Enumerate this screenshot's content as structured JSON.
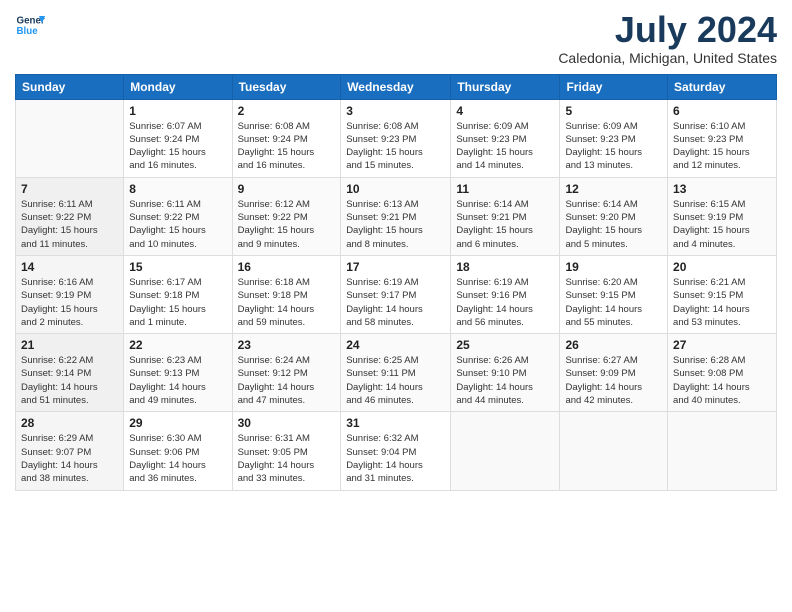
{
  "header": {
    "logo_line1": "General",
    "logo_line2": "Blue",
    "title": "July 2024",
    "subtitle": "Caledonia, Michigan, United States"
  },
  "calendar": {
    "days_of_week": [
      "Sunday",
      "Monday",
      "Tuesday",
      "Wednesday",
      "Thursday",
      "Friday",
      "Saturday"
    ],
    "weeks": [
      [
        {
          "day": "",
          "info": ""
        },
        {
          "day": "1",
          "info": "Sunrise: 6:07 AM\nSunset: 9:24 PM\nDaylight: 15 hours\nand 16 minutes."
        },
        {
          "day": "2",
          "info": "Sunrise: 6:08 AM\nSunset: 9:24 PM\nDaylight: 15 hours\nand 16 minutes."
        },
        {
          "day": "3",
          "info": "Sunrise: 6:08 AM\nSunset: 9:23 PM\nDaylight: 15 hours\nand 15 minutes."
        },
        {
          "day": "4",
          "info": "Sunrise: 6:09 AM\nSunset: 9:23 PM\nDaylight: 15 hours\nand 14 minutes."
        },
        {
          "day": "5",
          "info": "Sunrise: 6:09 AM\nSunset: 9:23 PM\nDaylight: 15 hours\nand 13 minutes."
        },
        {
          "day": "6",
          "info": "Sunrise: 6:10 AM\nSunset: 9:23 PM\nDaylight: 15 hours\nand 12 minutes."
        }
      ],
      [
        {
          "day": "7",
          "info": "Sunrise: 6:11 AM\nSunset: 9:22 PM\nDaylight: 15 hours\nand 11 minutes."
        },
        {
          "day": "8",
          "info": "Sunrise: 6:11 AM\nSunset: 9:22 PM\nDaylight: 15 hours\nand 10 minutes."
        },
        {
          "day": "9",
          "info": "Sunrise: 6:12 AM\nSunset: 9:22 PM\nDaylight: 15 hours\nand 9 minutes."
        },
        {
          "day": "10",
          "info": "Sunrise: 6:13 AM\nSunset: 9:21 PM\nDaylight: 15 hours\nand 8 minutes."
        },
        {
          "day": "11",
          "info": "Sunrise: 6:14 AM\nSunset: 9:21 PM\nDaylight: 15 hours\nand 6 minutes."
        },
        {
          "day": "12",
          "info": "Sunrise: 6:14 AM\nSunset: 9:20 PM\nDaylight: 15 hours\nand 5 minutes."
        },
        {
          "day": "13",
          "info": "Sunrise: 6:15 AM\nSunset: 9:19 PM\nDaylight: 15 hours\nand 4 minutes."
        }
      ],
      [
        {
          "day": "14",
          "info": "Sunrise: 6:16 AM\nSunset: 9:19 PM\nDaylight: 15 hours\nand 2 minutes."
        },
        {
          "day": "15",
          "info": "Sunrise: 6:17 AM\nSunset: 9:18 PM\nDaylight: 15 hours\nand 1 minute."
        },
        {
          "day": "16",
          "info": "Sunrise: 6:18 AM\nSunset: 9:18 PM\nDaylight: 14 hours\nand 59 minutes."
        },
        {
          "day": "17",
          "info": "Sunrise: 6:19 AM\nSunset: 9:17 PM\nDaylight: 14 hours\nand 58 minutes."
        },
        {
          "day": "18",
          "info": "Sunrise: 6:19 AM\nSunset: 9:16 PM\nDaylight: 14 hours\nand 56 minutes."
        },
        {
          "day": "19",
          "info": "Sunrise: 6:20 AM\nSunset: 9:15 PM\nDaylight: 14 hours\nand 55 minutes."
        },
        {
          "day": "20",
          "info": "Sunrise: 6:21 AM\nSunset: 9:15 PM\nDaylight: 14 hours\nand 53 minutes."
        }
      ],
      [
        {
          "day": "21",
          "info": "Sunrise: 6:22 AM\nSunset: 9:14 PM\nDaylight: 14 hours\nand 51 minutes."
        },
        {
          "day": "22",
          "info": "Sunrise: 6:23 AM\nSunset: 9:13 PM\nDaylight: 14 hours\nand 49 minutes."
        },
        {
          "day": "23",
          "info": "Sunrise: 6:24 AM\nSunset: 9:12 PM\nDaylight: 14 hours\nand 47 minutes."
        },
        {
          "day": "24",
          "info": "Sunrise: 6:25 AM\nSunset: 9:11 PM\nDaylight: 14 hours\nand 46 minutes."
        },
        {
          "day": "25",
          "info": "Sunrise: 6:26 AM\nSunset: 9:10 PM\nDaylight: 14 hours\nand 44 minutes."
        },
        {
          "day": "26",
          "info": "Sunrise: 6:27 AM\nSunset: 9:09 PM\nDaylight: 14 hours\nand 42 minutes."
        },
        {
          "day": "27",
          "info": "Sunrise: 6:28 AM\nSunset: 9:08 PM\nDaylight: 14 hours\nand 40 minutes."
        }
      ],
      [
        {
          "day": "28",
          "info": "Sunrise: 6:29 AM\nSunset: 9:07 PM\nDaylight: 14 hours\nand 38 minutes."
        },
        {
          "day": "29",
          "info": "Sunrise: 6:30 AM\nSunset: 9:06 PM\nDaylight: 14 hours\nand 36 minutes."
        },
        {
          "day": "30",
          "info": "Sunrise: 6:31 AM\nSunset: 9:05 PM\nDaylight: 14 hours\nand 33 minutes."
        },
        {
          "day": "31",
          "info": "Sunrise: 6:32 AM\nSunset: 9:04 PM\nDaylight: 14 hours\nand 31 minutes."
        },
        {
          "day": "",
          "info": ""
        },
        {
          "day": "",
          "info": ""
        },
        {
          "day": "",
          "info": ""
        }
      ]
    ]
  }
}
